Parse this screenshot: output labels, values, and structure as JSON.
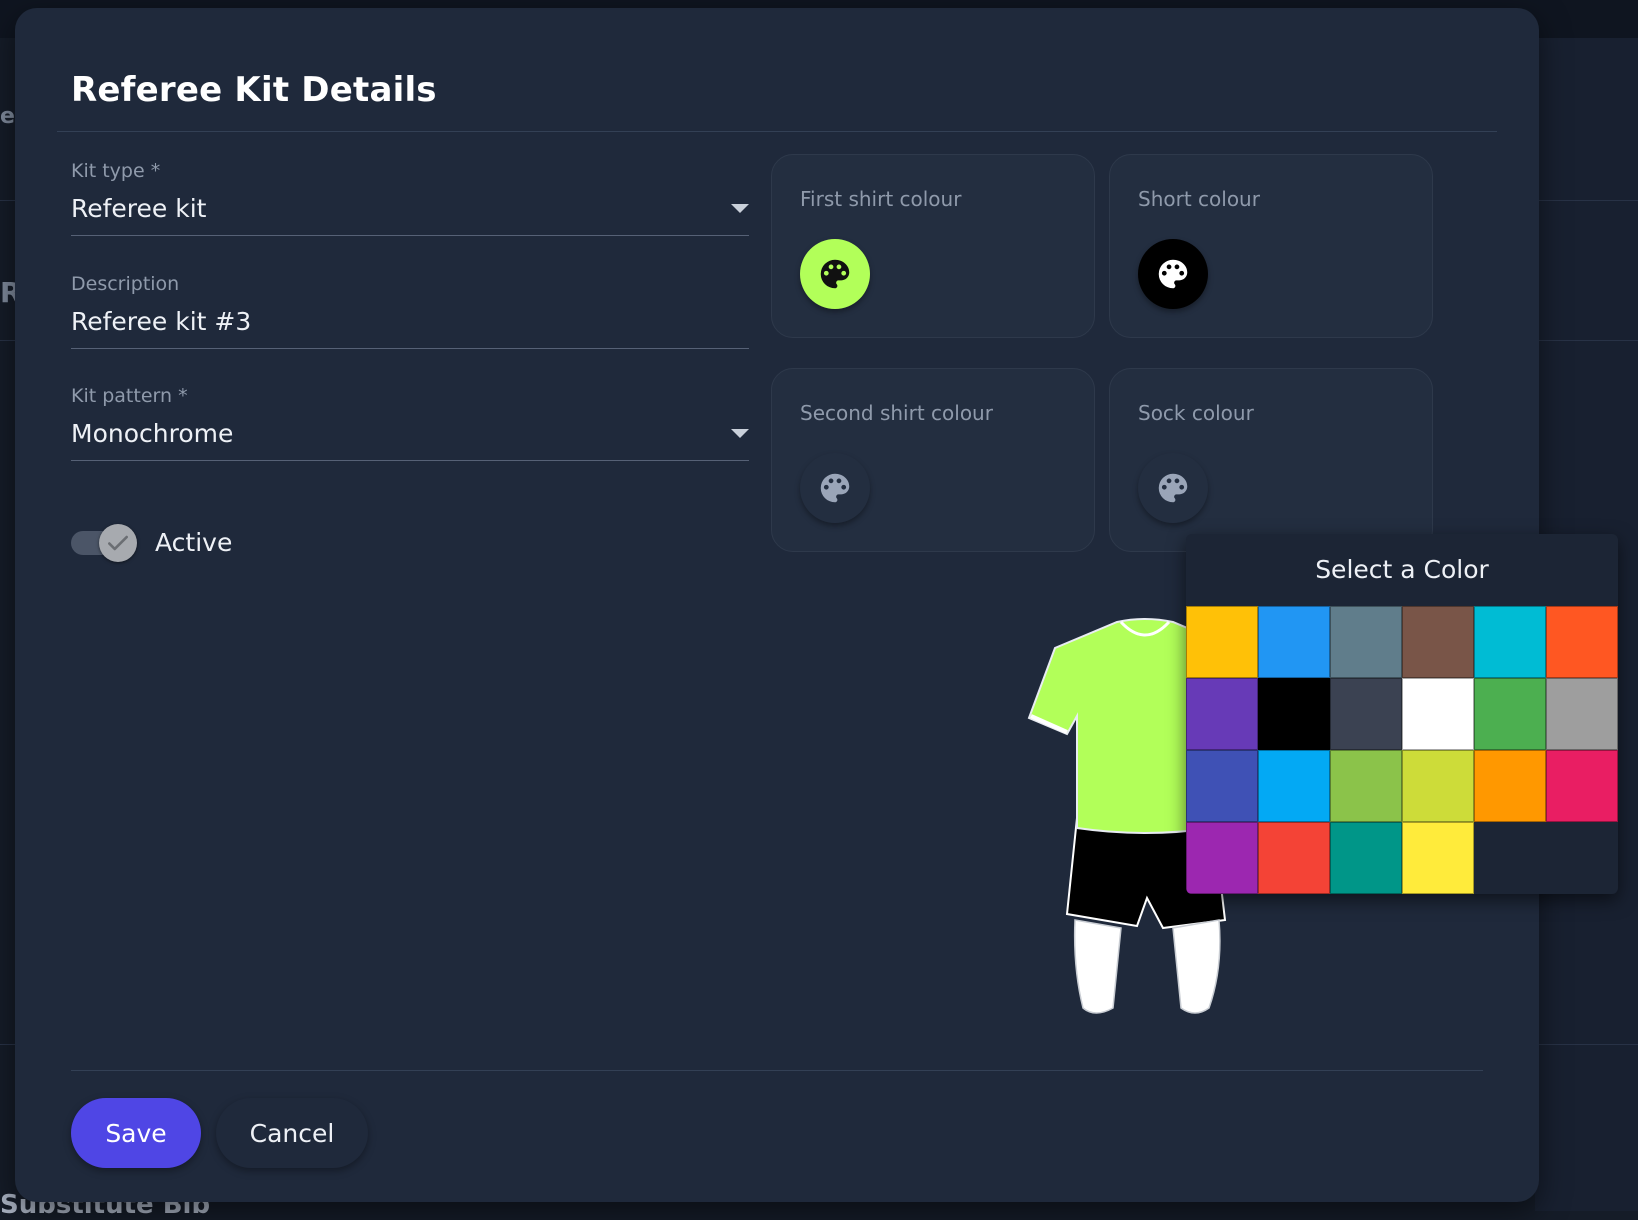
{
  "background": {
    "fragment_top": "efe",
    "fragment_mid": "R",
    "bottom_text": "Substitute Bib"
  },
  "dialog": {
    "title": "Referee Kit Details",
    "kit_type": {
      "label": "Kit type *",
      "value": "Referee kit"
    },
    "description": {
      "label": "Description",
      "value": "Referee kit #3"
    },
    "kit_pattern": {
      "label": "Kit pattern *",
      "value": "Monochrome"
    },
    "active": {
      "label": "Active",
      "checked": true
    },
    "colour_cards": {
      "first_shirt": {
        "label": "First shirt colour",
        "color": "#b2ff59",
        "icon": "palette-icon"
      },
      "short": {
        "label": "Short colour",
        "color": "#000000",
        "icon": "palette-icon"
      },
      "second_shirt": {
        "label": "Second shirt colour",
        "color": "",
        "icon": "palette-icon"
      },
      "sock": {
        "label": "Sock colour",
        "color": "",
        "icon": "palette-icon"
      }
    },
    "kit_preview": {
      "shirt_color": "#b2ff59",
      "shorts_color": "#000000",
      "socks_color": "#ffffff"
    },
    "color_picker": {
      "title": "Select a Color",
      "colors": [
        "#ffc107",
        "#2196f3",
        "#607d8b",
        "#795548",
        "#00bcd4",
        "#ff5722",
        "#673ab7",
        "#000000",
        "#3b4252",
        "#ffffff",
        "#4caf50",
        "#9e9e9e",
        "#3f51b5",
        "#03a9f4",
        "#8bc34a",
        "#cddc39",
        "#ff9800",
        "#e91e63",
        "#9c27b0",
        "#f44336",
        "#009688",
        "#ffeb3b"
      ]
    },
    "save_label": "Save",
    "cancel_label": "Cancel"
  }
}
